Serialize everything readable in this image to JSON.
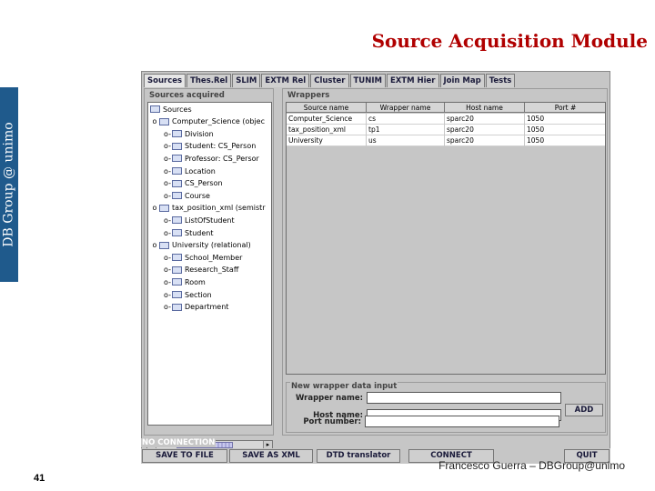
{
  "slide": {
    "title": "Source Acquisition Module",
    "sidebar_text": "DB Group @ unimo",
    "footer": "Francesco Guerra – DBGroup@unimo",
    "page_number": "41"
  },
  "app": {
    "tabs": [
      {
        "label": "Sources",
        "active": true
      },
      {
        "label": "Thes.Rel",
        "active": false
      },
      {
        "label": "SLIM",
        "active": false
      },
      {
        "label": "EXTM Rel",
        "active": false
      },
      {
        "label": "Cluster",
        "active": false
      },
      {
        "label": "TUNIM",
        "active": false
      },
      {
        "label": "EXTM Hier",
        "active": false
      },
      {
        "label": "Join Map",
        "active": false
      },
      {
        "label": "Tests",
        "active": false
      }
    ],
    "sources_panel": {
      "title": "Sources acquired",
      "tree": [
        {
          "label": "Sources",
          "level": 0,
          "toggle": ""
        },
        {
          "label": "Computer_Science (objec",
          "level": 1,
          "toggle": "o"
        },
        {
          "label": "Division",
          "level": 2,
          "toggle": "o-"
        },
        {
          "label": "Student: CS_Person",
          "level": 2,
          "toggle": "o-"
        },
        {
          "label": "Professor: CS_Persor",
          "level": 2,
          "toggle": "o-"
        },
        {
          "label": "Location",
          "level": 2,
          "toggle": "o-"
        },
        {
          "label": "CS_Person",
          "level": 2,
          "toggle": "o-"
        },
        {
          "label": "Course",
          "level": 2,
          "toggle": "o-"
        },
        {
          "label": "tax_position_xml (semistr",
          "level": 1,
          "toggle": "o"
        },
        {
          "label": "ListOfStudent",
          "level": 2,
          "toggle": "o-"
        },
        {
          "label": "Student",
          "level": 2,
          "toggle": "o-"
        },
        {
          "label": "University (relational)",
          "level": 1,
          "toggle": "o"
        },
        {
          "label": "School_Member",
          "level": 2,
          "toggle": "o-"
        },
        {
          "label": "Research_Staff",
          "level": 2,
          "toggle": "o-"
        },
        {
          "label": "Room",
          "level": 2,
          "toggle": "o-"
        },
        {
          "label": "Section",
          "level": 2,
          "toggle": "o-"
        },
        {
          "label": "Department",
          "level": 2,
          "toggle": "o-"
        }
      ],
      "scroll_left": "◂",
      "scroll_right": "▸"
    },
    "wrappers_panel": {
      "title": "Wrappers",
      "columns": [
        "Source name",
        "Wrapper name",
        "Host name",
        "Port #"
      ],
      "rows": [
        [
          "Computer_Science",
          "cs",
          "sparc20",
          "1050"
        ],
        [
          "tax_position_xml",
          "tp1",
          "sparc20",
          "1050"
        ],
        [
          "University",
          "us",
          "sparc20",
          "1050"
        ]
      ]
    },
    "new_wrapper": {
      "title": "New wrapper data input",
      "wrapper_label": "Wrapper name:",
      "wrapper_value": "",
      "host_label": "Host name:",
      "host_value": "",
      "port_label": "Port number:",
      "port_value": "",
      "add_label": "ADD"
    },
    "status_text": "NO CONNECTION",
    "buttons": {
      "save_to_file": "SAVE TO FILE",
      "save_as_xml": "SAVE AS XML",
      "dtd_translator": "DTD translator",
      "connect": "CONNECT",
      "quit": "QUIT"
    }
  }
}
